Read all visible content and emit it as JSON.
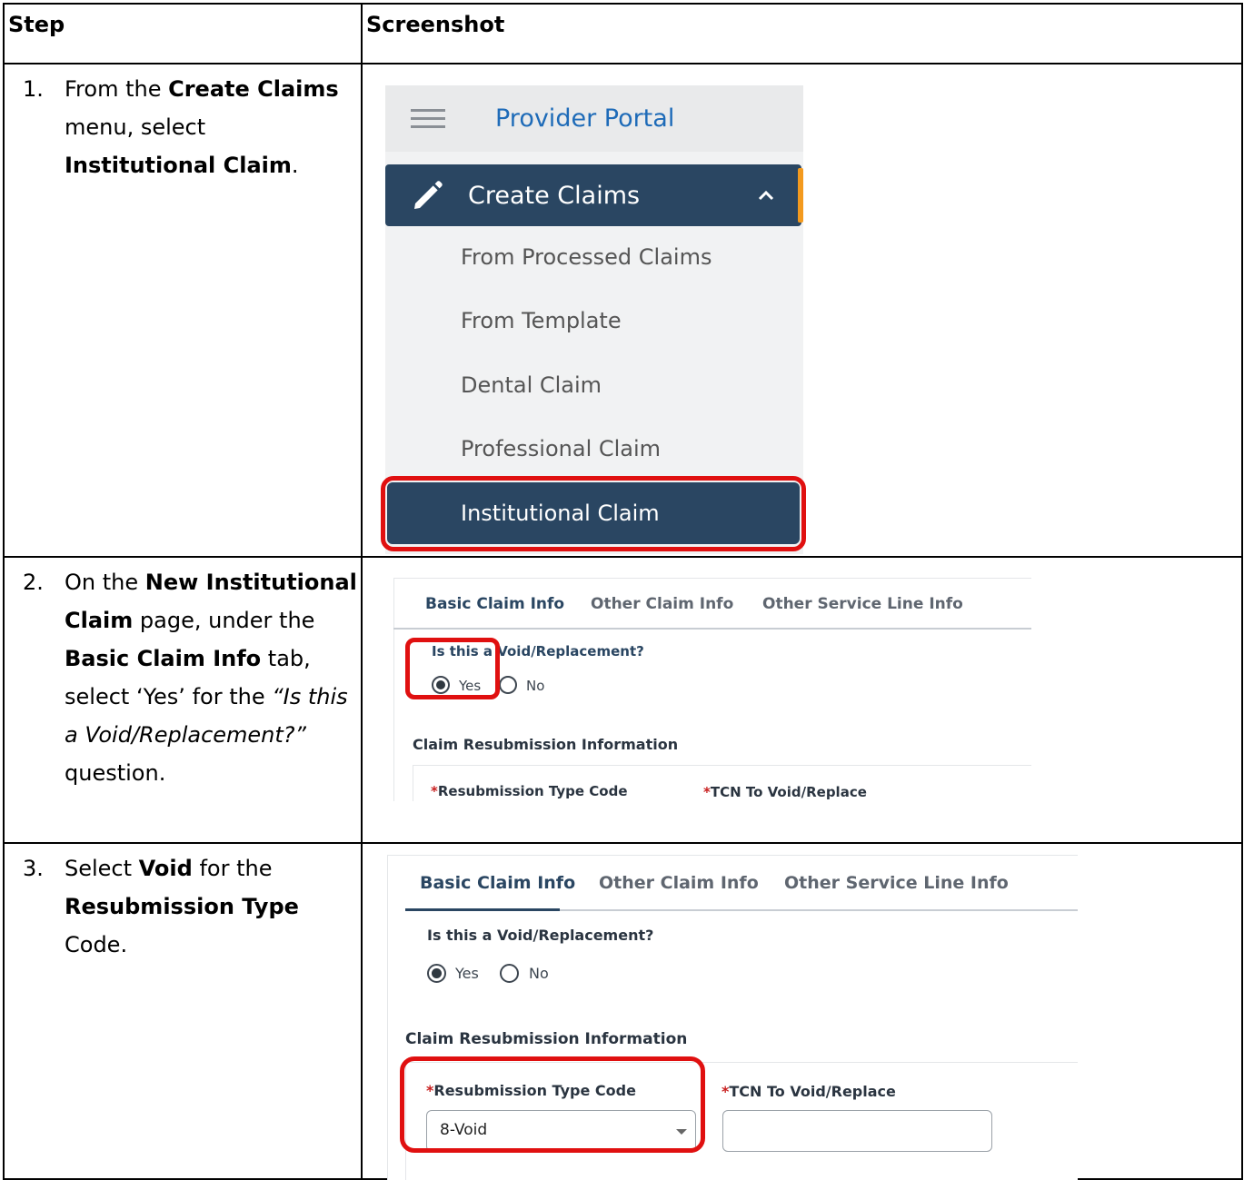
{
  "table": {
    "header_step": "Step",
    "header_screenshot": "Screenshot"
  },
  "steps": [
    {
      "num": "1.",
      "parts": [
        {
          "t": "From the "
        },
        {
          "t": "Create Claims",
          "b": true
        },
        {
          "t": " menu, select "
        },
        {
          "t": "Institutional Claim",
          "b": true
        },
        {
          "t": "."
        }
      ]
    },
    {
      "num": "2.",
      "parts": [
        {
          "t": "On the "
        },
        {
          "t": "New Institutional Claim",
          "b": true
        },
        {
          "t": " page, under the "
        },
        {
          "t": "Basic Claim Info",
          "b": true
        },
        {
          "t": " tab, select ‘Yes’ for the "
        },
        {
          "t": "“Is this a Void/Replacement?”",
          "i": true
        },
        {
          "t": " question."
        }
      ]
    },
    {
      "num": "3.",
      "parts": [
        {
          "t": "Select "
        },
        {
          "t": "Void",
          "b": true
        },
        {
          "t": " for the "
        },
        {
          "t": "Resubmission Type",
          "b": true
        },
        {
          "t": " Code."
        }
      ]
    }
  ],
  "menu": {
    "portal_title": "Provider Portal",
    "create_claims": "Create Claims",
    "items": [
      "From Processed Claims",
      "From Template",
      "Dental Claim",
      "Professional Claim"
    ],
    "selected_item": "Institutional Claim"
  },
  "form": {
    "tabs": [
      "Basic Claim Info",
      "Other Claim Info",
      "Other Service Line Info"
    ],
    "question": "Is this a Void/Replacement?",
    "yes": "Yes",
    "no": "No",
    "section": "Claim Resubmission Information",
    "req_mark": "*",
    "field1": "Resubmission Type Code",
    "field2": "TCN To Void/Replace",
    "field1_value": "8-Void",
    "field2_value": ""
  },
  "colors": {
    "navy": "#2a4662",
    "highlight_red": "#e01010",
    "accent_orange": "#f39a1e",
    "link_blue": "#1e6bb8"
  }
}
